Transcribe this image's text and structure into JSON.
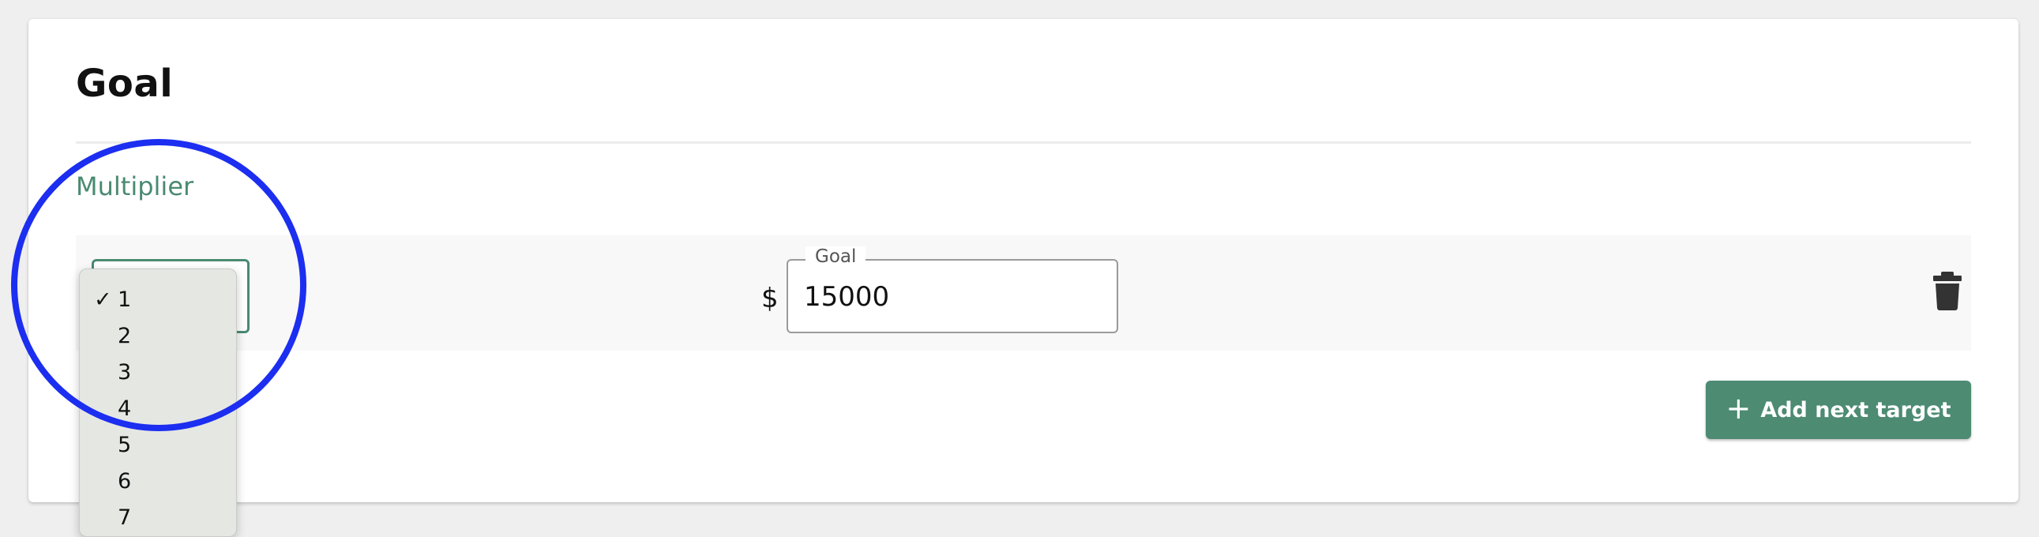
{
  "card": {
    "title": "Goal",
    "section_label": "Multiplier"
  },
  "target_row": {
    "multiplier_selected": "1",
    "currency_symbol": "$",
    "goal_legend": "Goal",
    "goal_value": "15000",
    "delete_icon": "trash-icon"
  },
  "add_button": {
    "icon": "plus-icon",
    "label": "Add next target"
  },
  "dropdown": {
    "options": [
      {
        "label": "1",
        "checked": true
      },
      {
        "label": "2",
        "checked": false
      },
      {
        "label": "3",
        "checked": false
      },
      {
        "label": "4",
        "checked": false
      },
      {
        "label": "5",
        "checked": false
      },
      {
        "label": "6",
        "checked": false
      },
      {
        "label": "7",
        "checked": false
      }
    ]
  },
  "colors": {
    "accent": "#4a8a72",
    "button": "#4d8b73",
    "annotation": "#1c2ef0"
  }
}
